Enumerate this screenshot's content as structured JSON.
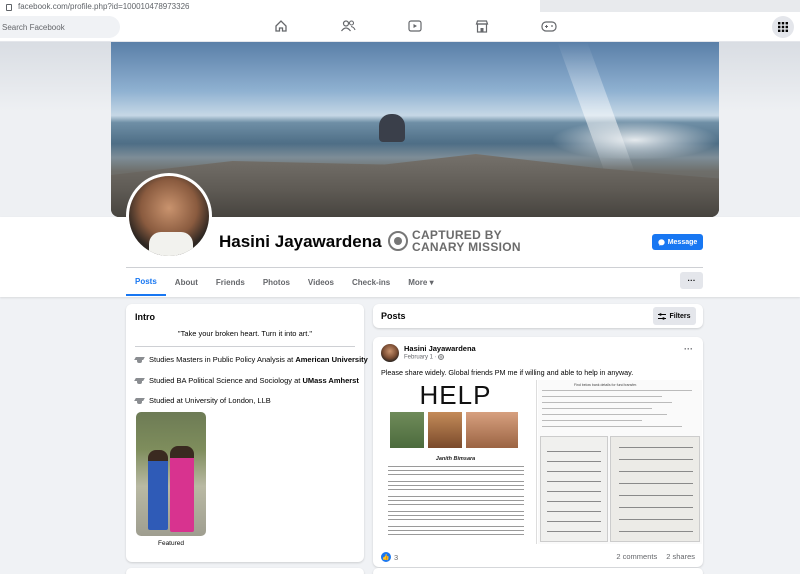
{
  "browser": {
    "url": "facebook.com/profile.php?id=100010478973326"
  },
  "topnav": {
    "search_placeholder": "Search Facebook",
    "icons": [
      "home-icon",
      "friends-icon",
      "watch-icon",
      "marketplace-icon",
      "gaming-icon",
      "menu-grid-icon"
    ]
  },
  "profile": {
    "name": "Hasini Jayawardena",
    "message_label": "Message",
    "watermark_line1": "CAPTURED BY",
    "watermark_line2": "CANARY MISSION"
  },
  "tabs": [
    {
      "label": "Posts",
      "active": true
    },
    {
      "label": "About"
    },
    {
      "label": "Friends"
    },
    {
      "label": "Photos"
    },
    {
      "label": "Videos"
    },
    {
      "label": "Check-ins"
    },
    {
      "label": "More ▾"
    }
  ],
  "more_button": "···",
  "intro": {
    "title": "Intro",
    "bio": "\"Take your broken heart. Turn it into art.\"",
    "education": [
      {
        "prefix": "Studies Masters in Public Policy Analysis at ",
        "school": "American University"
      },
      {
        "prefix": "Studied BA Political Science and Sociology at ",
        "school": "UMass Amherst"
      },
      {
        "prefix": "Studied at University of London, LLB",
        "school": ""
      }
    ],
    "featured_label": "Featured"
  },
  "posts_header": {
    "title": "Posts",
    "filters_label": "Filters"
  },
  "post": {
    "author": "Hasini Jayawardena",
    "date": "February 1 · ",
    "text": "Please share widely. Global friends PM me if willing and able to help in anyway.",
    "image_left": {
      "heading": "HELP",
      "caption": "Janith Bimsara"
    },
    "image_right": {
      "heading": "Find below bank details for fund transfer.",
      "rows": [
        "Name of Account:",
        "Account Number:",
        "Bank:",
        "Branch:",
        "Swift Code:"
      ]
    },
    "reactions_count": "3",
    "comments": "2 comments",
    "shares": "2 shares"
  },
  "colors": {
    "accent": "#1877f2",
    "background": "#f0f2f5"
  }
}
